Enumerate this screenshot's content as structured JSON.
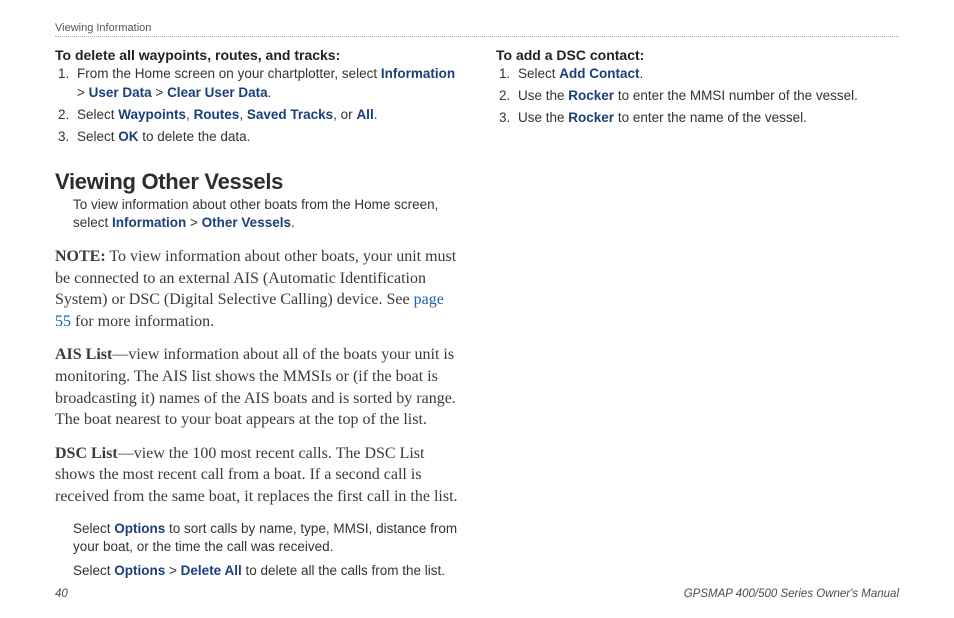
{
  "header": "Viewing Information",
  "left": {
    "deleteTitle": "To delete all waypoints, routes, and tracks:",
    "d1a": "From the Home screen on your chartplotter, select ",
    "k_info": "Information",
    "gt": " > ",
    "k_user": "User Data",
    "k_clear": "Clear User Data",
    "dot": ".",
    "d2a": "Select ",
    "k_wp": "Waypoints",
    "comma": ", ",
    "k_routes": "Routes",
    "k_saved": "Saved Tracks",
    "or": ", or ",
    "k_all": "All",
    "d3a": "Select ",
    "k_ok": "OK",
    "d3b": " to delete the data.",
    "sectionTitle": "Viewing Other Vessels",
    "intro1": "To view information about other boats from the Home screen, select ",
    "k_other": "Other Vessels",
    "note_b": "NOTE:",
    "note_t": " To view information about other boats, your unit must be connected to an external AIS (Automatic Identification System) or DSC (Digital Selective Calling) device. See ",
    "note_link": "page 55",
    "note_end": " for more information.",
    "ais_b": "AIS List",
    "ais_t": "—view information about all of the boats your unit is monitoring. The AIS list shows the MMSIs or (if the boat is broadcasting it) names of the AIS boats and is sorted by range. The boat nearest to your boat appears at the top of the list.",
    "dsc_b": "DSC List",
    "dsc_t": "—view the 100 most recent calls. The DSC List shows the most recent call from a boat. If a second call is received from the same boat, it replaces the first call in the list.",
    "sub1a": "Select ",
    "k_opt": "Options",
    "sub1b": " to sort calls by name, type, MMSI, distance from your boat, or the time the call was received.",
    "sub2a": "Select ",
    "k_del": "Delete All",
    "sub2b": " to delete all the calls from the list."
  },
  "right": {
    "addTitle": "To add a DSC contact:",
    "r1a": "Select ",
    "k_add": "Add Contact",
    "r2a": "Use the ",
    "k_rocker": "Rocker",
    "r2b": " to enter the MMSI number of the vessel.",
    "r3b": " to enter the name of the vessel."
  },
  "footer": {
    "page": "40",
    "title": "GPSMAP 400/500 Series Owner's Manual"
  }
}
